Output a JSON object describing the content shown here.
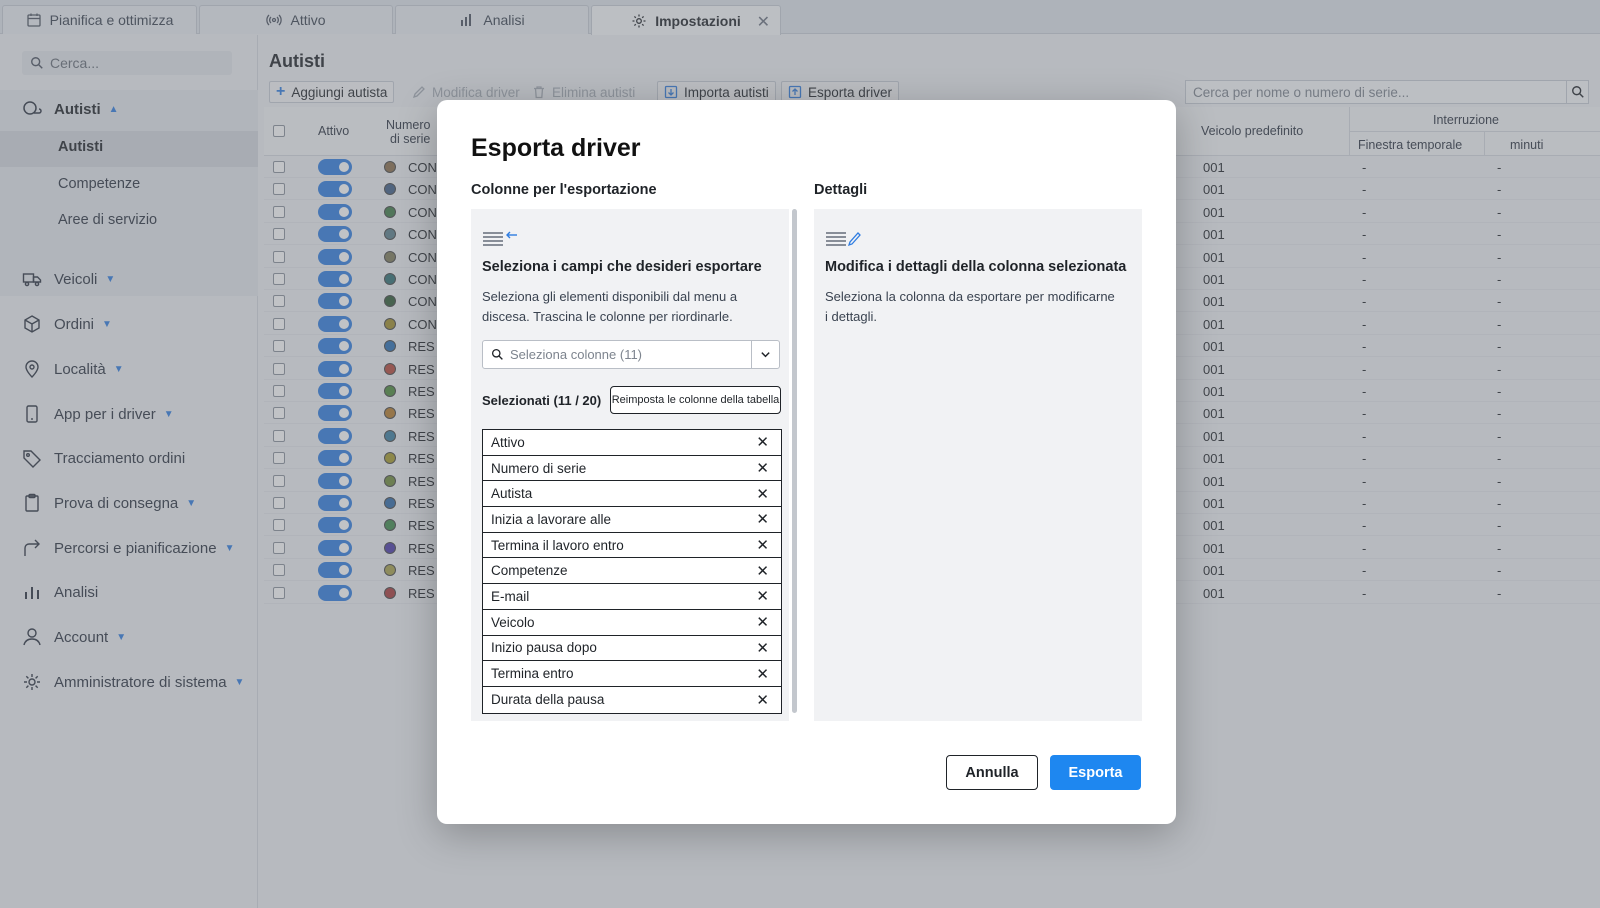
{
  "tabs": [
    {
      "label": "Pianifica e ottimizza",
      "icon": "calendar-icon"
    },
    {
      "label": "Attivo",
      "icon": "broadcast-icon"
    },
    {
      "label": "Analisi",
      "icon": "bar-chart-icon"
    },
    {
      "label": "Impostazioni",
      "icon": "gear-icon",
      "active": true
    }
  ],
  "sidebar": {
    "search_placeholder": "Cerca...",
    "autisti": "Autisti",
    "sub": [
      "Autisti",
      "Competenze",
      "Aree di servizio"
    ],
    "items": [
      "Veicoli",
      "Ordini",
      "Località",
      "App per i driver",
      "Tracciamento ordini",
      "Prova di consegna",
      "Percorsi e pianificazione",
      "Analisi",
      "Account",
      "Amministratore di sistema"
    ]
  },
  "main": {
    "title": "Autisti",
    "toolbar": {
      "add": "Aggiungi autista",
      "edit": "Modifica driver",
      "delete": "Elimina autisti",
      "import": "Importa autisti",
      "export": "Esporta driver"
    },
    "search_placeholder": "Cerca per nome o numero di serie...",
    "columns": {
      "active": "Attivo",
      "serial_1": "Numero",
      "serial_2": "di serie",
      "vehicle": "Veicolo predefinito",
      "break": "Interruzione",
      "window": "Finestra temporale",
      "minutes": "minuti"
    },
    "rows": [
      {
        "serial": "CON",
        "color": "#8a6d4a",
        "vehicle": "001",
        "window": "-",
        "minutes": "-"
      },
      {
        "serial": "CON",
        "color": "#3f5d85",
        "vehicle": "001",
        "window": "-",
        "minutes": "-"
      },
      {
        "serial": "CON",
        "color": "#3f7a45",
        "vehicle": "001",
        "window": "-",
        "minutes": "-"
      },
      {
        "serial": "CON",
        "color": "#5b7f8a",
        "vehicle": "001",
        "window": "-",
        "minutes": "-"
      },
      {
        "serial": "CON",
        "color": "#7e7a58",
        "vehicle": "001",
        "window": "-",
        "minutes": "-"
      },
      {
        "serial": "CON",
        "color": "#2f6f73",
        "vehicle": "001",
        "window": "-",
        "minutes": "-"
      },
      {
        "serial": "CON",
        "color": "#2f5a35",
        "vehicle": "001",
        "window": "-",
        "minutes": "-"
      },
      {
        "serial": "CON",
        "color": "#a18d2a",
        "vehicle": "001",
        "window": "-",
        "minutes": "-"
      },
      {
        "serial": "RES",
        "color": "#2a6fb3",
        "vehicle": "001",
        "window": "-",
        "minutes": "-"
      },
      {
        "serial": "RES",
        "color": "#b5483a",
        "vehicle": "001",
        "window": "-",
        "minutes": "-"
      },
      {
        "serial": "RES",
        "color": "#4c8a3a",
        "vehicle": "001",
        "window": "-",
        "minutes": "-"
      },
      {
        "serial": "RES",
        "color": "#b57a2a",
        "vehicle": "001",
        "window": "-",
        "minutes": "-"
      },
      {
        "serial": "RES",
        "color": "#3b7ea1",
        "vehicle": "001",
        "window": "-",
        "minutes": "-"
      },
      {
        "serial": "RES",
        "color": "#a69a2a",
        "vehicle": "001",
        "window": "-",
        "minutes": "-"
      },
      {
        "serial": "RES",
        "color": "#6f8a3a",
        "vehicle": "001",
        "window": "-",
        "minutes": "-"
      },
      {
        "serial": "RES",
        "color": "#2f6aa8",
        "vehicle": "001",
        "window": "-",
        "minutes": "-"
      },
      {
        "serial": "RES",
        "color": "#3f8a4a",
        "vehicle": "001",
        "window": "-",
        "minutes": "-"
      },
      {
        "serial": "RES",
        "color": "#4b3aa8",
        "vehicle": "001",
        "window": "-",
        "minutes": "-"
      },
      {
        "serial": "RES",
        "color": "#a8a04a",
        "vehicle": "001",
        "window": "-",
        "minutes": "-"
      },
      {
        "serial": "RES",
        "color": "#a83a3a",
        "vehicle": "001",
        "window": "-",
        "minutes": "-"
      }
    ]
  },
  "modal": {
    "title": "Esporta driver",
    "left_label": "Colonne per l'esportazione",
    "right_label": "Dettagli",
    "left_title": "Seleziona i campi che desideri esportare",
    "left_desc": "Seleziona gli elementi disponibili dal menu a discesa. Trascina le colonne per riordinarle.",
    "select_placeholder": "Seleziona colonne (11)",
    "selected_count": "Selezionati (11 / 20)",
    "reset": "Reimposta le colonne della tabella",
    "selected_columns": [
      "Attivo",
      "Numero di serie",
      "Autista",
      "Inizia a lavorare alle",
      "Termina il lavoro entro",
      "Competenze",
      "E-mail",
      "Veicolo",
      "Inizio pausa dopo",
      "Termina entro",
      "Durata della pausa"
    ],
    "remove_glyph": "✕",
    "right_title": "Modifica i dettagli della colonna selezionata",
    "right_desc": "Seleziona la colonna da esportare per modificarne i dettagli.",
    "cancel": "Annulla",
    "export": "Esporta"
  },
  "colors": {
    "accent": "#1e87f0",
    "toggle": "#2f7de1"
  }
}
